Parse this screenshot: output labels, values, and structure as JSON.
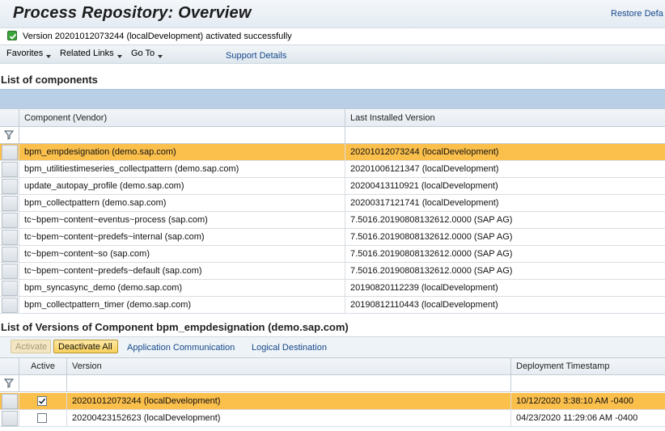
{
  "header": {
    "title": "Process Repository: Overview",
    "restore_link": "Restore Defa"
  },
  "message": {
    "text": "Version 20201012073244 (localDevelopment) activated successfully",
    "icon": "success-check-icon"
  },
  "menu": {
    "items": [
      {
        "label": "Favorites"
      },
      {
        "label": "Related Links"
      },
      {
        "label": "Go To"
      }
    ],
    "support_link": "Support Details"
  },
  "components_section": {
    "title": "List of components",
    "columns": [
      "Component (Vendor)",
      "Last Installed Version"
    ],
    "rows": [
      {
        "component": "bpm_empdesignation (demo.sap.com)",
        "version": "20201012073244 (localDevelopment)",
        "selected": true
      },
      {
        "component": "bpm_utilitiestimeseries_collectpattern (demo.sap.com)",
        "version": "20201006121347 (localDevelopment)"
      },
      {
        "component": "update_autopay_profile (demo.sap.com)",
        "version": "20200413110921 (localDevelopment)"
      },
      {
        "component": "bpm_collectpattern (demo.sap.com)",
        "version": "20200317121741 (localDevelopment)"
      },
      {
        "component": "tc~bpem~content~eventus~process (sap.com)",
        "version": "7.5016.20190808132612.0000 (SAP AG)"
      },
      {
        "component": "tc~bpem~content~predefs~internal (sap.com)",
        "version": "7.5016.20190808132612.0000 (SAP AG)"
      },
      {
        "component": "tc~bpem~content~so (sap.com)",
        "version": "7.5016.20190808132612.0000 (SAP AG)"
      },
      {
        "component": "tc~bpem~content~predefs~default (sap.com)",
        "version": "7.5016.20190808132612.0000 (SAP AG)"
      },
      {
        "component": "bpm_syncasync_demo (demo.sap.com)",
        "version": "20190820112239 (localDevelopment)"
      },
      {
        "component": "bpm_collectpattern_timer (demo.sap.com)",
        "version": "20190812110443 (localDevelopment)"
      }
    ]
  },
  "versions_section": {
    "title": "List of Versions of Component bpm_empdesignation (demo.sap.com)",
    "buttons": {
      "activate": "Activate",
      "deactivate_all": "Deactivate All"
    },
    "links": {
      "app_comm": "Application Communication",
      "logical_dest": "Logical Destination"
    },
    "columns": [
      "Active",
      "Version",
      "Deployment Timestamp"
    ],
    "rows": [
      {
        "active": true,
        "version": "20201012073244 (localDevelopment)",
        "timestamp": "10/12/2020 3:38:10 AM -0400",
        "selected": true
      },
      {
        "active": false,
        "version": "20200423152623 (localDevelopment)",
        "timestamp": "04/23/2020 11:29:06 AM -0400"
      }
    ]
  }
}
